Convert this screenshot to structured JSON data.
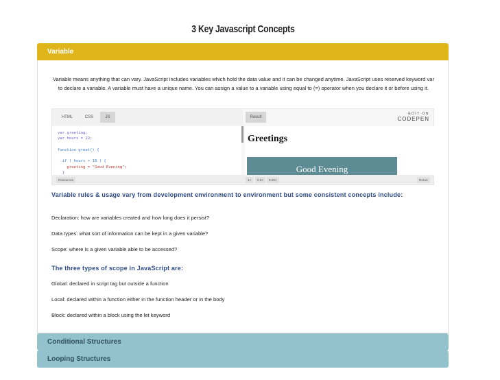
{
  "page": {
    "title": "3 Key Javascript Concepts"
  },
  "sections": [
    {
      "label": "Variable",
      "intro": "Variable means anything that can vary. JavaScript includes variables which hold the data value and it can be changed anytime. JavaScript uses reserved keyword var to declare a variable. A variable must have a unique name. You can assign a value to a variable using equal to (=) operator when you declare it or before using it.",
      "codepen": {
        "tabs": [
          "HTML",
          "CSS",
          "JS"
        ],
        "selected_tab": "JS",
        "code_lines": [
          "var greeting;",
          "var hours = 22;",
          "",
          "function greet() {",
          "",
          "  if ( hours > 18 ) {",
          "    greeting = \"Good Evening\";",
          "  }"
        ],
        "result_tab": "Result",
        "brand_edit": "EDIT ON",
        "brand_name": "CODEPEN",
        "output_heading": "Greetings",
        "output_box": "Good Evening",
        "footer": {
          "resources": "Resources",
          "zoom": [
            "1×",
            "0.5×",
            "0.25×"
          ],
          "rerun": "Rerun"
        }
      },
      "rules_heading": "Variable rules & usage vary from development environment to environment but some consistent concepts include:",
      "concepts": [
        "Declaration: how are variables created and how long does it persist?",
        "Data types: what sort of information can be kept in a given variable?",
        "Scope: where is a given variable able to be accessed?"
      ],
      "scope_heading": "The three types of scope in JavaScript are:",
      "scopes": [
        "Global: declared in script tag but outside a function",
        "Local: declared within a function either in the function header or in the body",
        "Block: declared within a block using the let keyword"
      ]
    },
    {
      "label": "Conditional Structures"
    },
    {
      "label": "Looping Structures"
    }
  ],
  "colors": {
    "active_header": "#e0b51a",
    "collapsed_header": "#93c2cd",
    "heading_blue": "#2d4a8a"
  }
}
